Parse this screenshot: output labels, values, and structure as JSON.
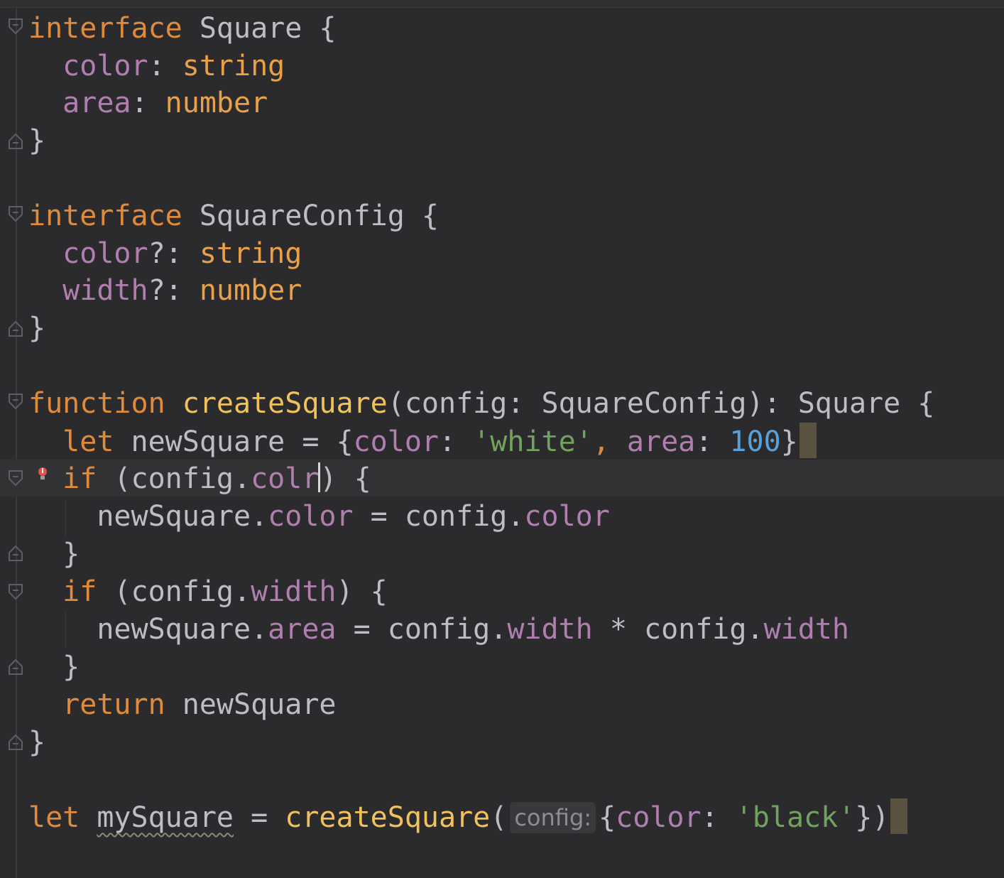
{
  "editor": {
    "lines": [
      {
        "tokens": [
          {
            "t": "interface",
            "c": "kw"
          },
          {
            "t": " Square {",
            "c": "plain"
          }
        ]
      },
      {
        "tokens": [
          {
            "t": "  ",
            "c": "plain"
          },
          {
            "t": "color",
            "c": "prop"
          },
          {
            "t": ": ",
            "c": "plain"
          },
          {
            "t": "string",
            "c": "type"
          }
        ]
      },
      {
        "tokens": [
          {
            "t": "  ",
            "c": "plain"
          },
          {
            "t": "area",
            "c": "prop"
          },
          {
            "t": ": ",
            "c": "plain"
          },
          {
            "t": "number",
            "c": "type"
          }
        ]
      },
      {
        "tokens": [
          {
            "t": "}",
            "c": "plain"
          }
        ]
      },
      {
        "tokens": [
          {
            "t": "interface",
            "c": "kw"
          },
          {
            "t": " SquareConfig {",
            "c": "plain"
          }
        ]
      },
      {
        "tokens": [
          {
            "t": "  ",
            "c": "plain"
          },
          {
            "t": "color",
            "c": "prop"
          },
          {
            "t": "?: ",
            "c": "plain"
          },
          {
            "t": "string",
            "c": "type"
          }
        ]
      },
      {
        "tokens": [
          {
            "t": "  ",
            "c": "plain"
          },
          {
            "t": "width",
            "c": "prop"
          },
          {
            "t": "?: ",
            "c": "plain"
          },
          {
            "t": "number",
            "c": "type"
          }
        ]
      },
      {
        "tokens": [
          {
            "t": "}",
            "c": "plain"
          }
        ]
      },
      {
        "tokens": [
          {
            "t": "function",
            "c": "kw"
          },
          {
            "t": " ",
            "c": "plain"
          },
          {
            "t": "createSquare",
            "c": "fn"
          },
          {
            "t": "(config: SquareConfig): Square {",
            "c": "plain"
          }
        ]
      },
      {
        "tokens": [
          {
            "t": "  ",
            "c": "plain"
          },
          {
            "t": "let",
            "c": "kw"
          },
          {
            "t": " newSquare = {",
            "c": "plain"
          },
          {
            "t": "color",
            "c": "prop"
          },
          {
            "t": ": ",
            "c": "plain"
          },
          {
            "t": "'white'",
            "c": "str"
          },
          {
            "t": ", ",
            "c": "kw"
          },
          {
            "t": "area",
            "c": "prop"
          },
          {
            "t": ": ",
            "c": "plain"
          },
          {
            "t": "100",
            "c": "num"
          },
          {
            "t": "}",
            "c": "plain"
          },
          {
            "t": "",
            "c": "caret-block"
          }
        ]
      },
      {
        "tokens": [
          {
            "t": "  ",
            "c": "plain"
          },
          {
            "t": "if",
            "c": "kw"
          },
          {
            "t": " (config.",
            "c": "plain"
          },
          {
            "t": "colr",
            "c": "prop"
          },
          {
            "t": "",
            "c": "caret"
          },
          {
            "t": ") {",
            "c": "plain"
          }
        ]
      },
      {
        "tokens": [
          {
            "t": "    newSquare.",
            "c": "plain"
          },
          {
            "t": "color",
            "c": "prop"
          },
          {
            "t": " = config.",
            "c": "plain"
          },
          {
            "t": "color",
            "c": "prop"
          }
        ]
      },
      {
        "tokens": [
          {
            "t": "  }",
            "c": "plain"
          }
        ]
      },
      {
        "tokens": [
          {
            "t": "  ",
            "c": "plain"
          },
          {
            "t": "if",
            "c": "kw"
          },
          {
            "t": " (config.",
            "c": "plain"
          },
          {
            "t": "width",
            "c": "prop"
          },
          {
            "t": ") {",
            "c": "plain"
          }
        ]
      },
      {
        "tokens": [
          {
            "t": "    newSquare.",
            "c": "plain"
          },
          {
            "t": "area",
            "c": "prop"
          },
          {
            "t": " = config.",
            "c": "plain"
          },
          {
            "t": "width",
            "c": "prop"
          },
          {
            "t": " * config.",
            "c": "plain"
          },
          {
            "t": "width",
            "c": "prop"
          }
        ]
      },
      {
        "tokens": [
          {
            "t": "  }",
            "c": "plain"
          }
        ]
      },
      {
        "tokens": [
          {
            "t": "  ",
            "c": "plain"
          },
          {
            "t": "return",
            "c": "kw"
          },
          {
            "t": " newSquare",
            "c": "plain"
          }
        ]
      },
      {
        "tokens": [
          {
            "t": "}",
            "c": "plain"
          }
        ]
      },
      {
        "tokens": [
          {
            "t": "let",
            "c": "kw"
          },
          {
            "t": " ",
            "c": "plain"
          },
          {
            "t": "mySquare",
            "c": "squiggle"
          },
          {
            "t": " = ",
            "c": "plain"
          },
          {
            "t": "createSquare",
            "c": "fn"
          },
          {
            "t": "(",
            "c": "plain"
          },
          {
            "t": "config:",
            "c": "hint"
          },
          {
            "t": "{",
            "c": "plain"
          },
          {
            "t": "color",
            "c": "prop"
          },
          {
            "t": ": ",
            "c": "plain"
          },
          {
            "t": "'black'",
            "c": "str"
          },
          {
            "t": "})",
            "c": "plain"
          },
          {
            "t": "",
            "c": "caret-block"
          }
        ]
      }
    ]
  },
  "colors": {
    "background": "#2b2b2d",
    "keyword": "#e08a3c",
    "function": "#f1c15b",
    "property": "#b07fb0",
    "string": "#72a35e",
    "number": "#5b9fd8",
    "text": "#bcbec4"
  },
  "icons": [
    "fold-icon",
    "error-bulb-icon"
  ]
}
